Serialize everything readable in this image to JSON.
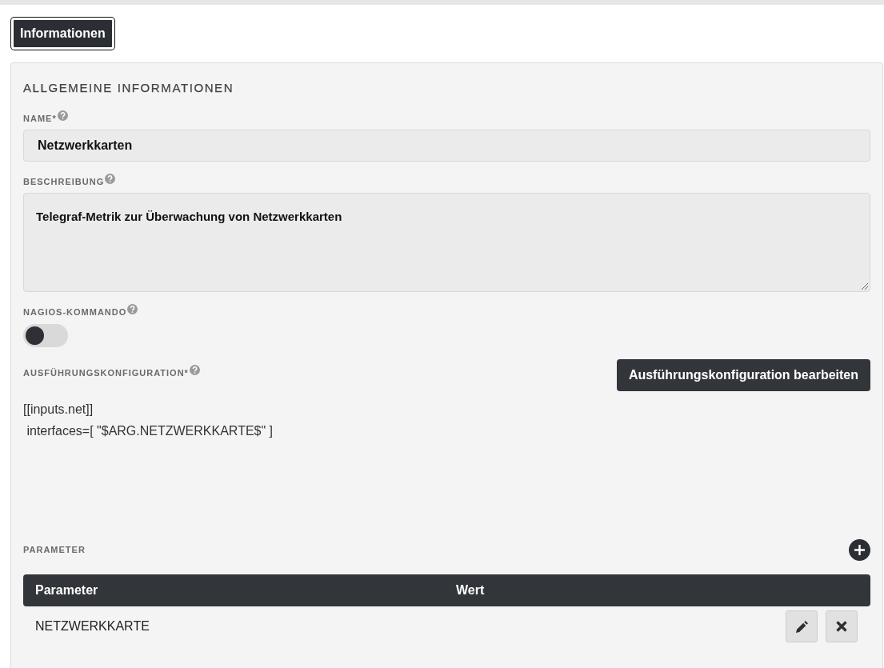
{
  "tabs": [
    {
      "label": "Informationen",
      "selected": true
    }
  ],
  "section": {
    "title": "ALLGEMEINE INFORMATIONEN",
    "fields": [
      {
        "kind": "text",
        "label": "NAME*",
        "help": true,
        "value": "Netzwerkkarten"
      },
      {
        "kind": "textarea",
        "label": "BESCHREIBUNG",
        "help": true,
        "value": "Telegraf-Metrik zur Überwachung von Netzwerkkarten"
      },
      {
        "kind": "toggle",
        "label": "NAGIOS-KOMMANDO",
        "help": true,
        "on": false
      },
      {
        "kind": "config",
        "label": "AUSFÜHRUNGSKONFIGURATION*",
        "help": true,
        "button": "Ausführungskonfiguration bearbeiten",
        "code_lines": [
          "[[inputs.net]]",
          " interfaces=[ \"$ARG.NETZWERKKARTE$\" ]"
        ]
      }
    ]
  },
  "parameters": {
    "label": "PARAMETER",
    "columns": [
      "Parameter",
      "Wert"
    ],
    "rows": [
      {
        "parameter": "NETZWERKKARTE"
      }
    ]
  }
}
